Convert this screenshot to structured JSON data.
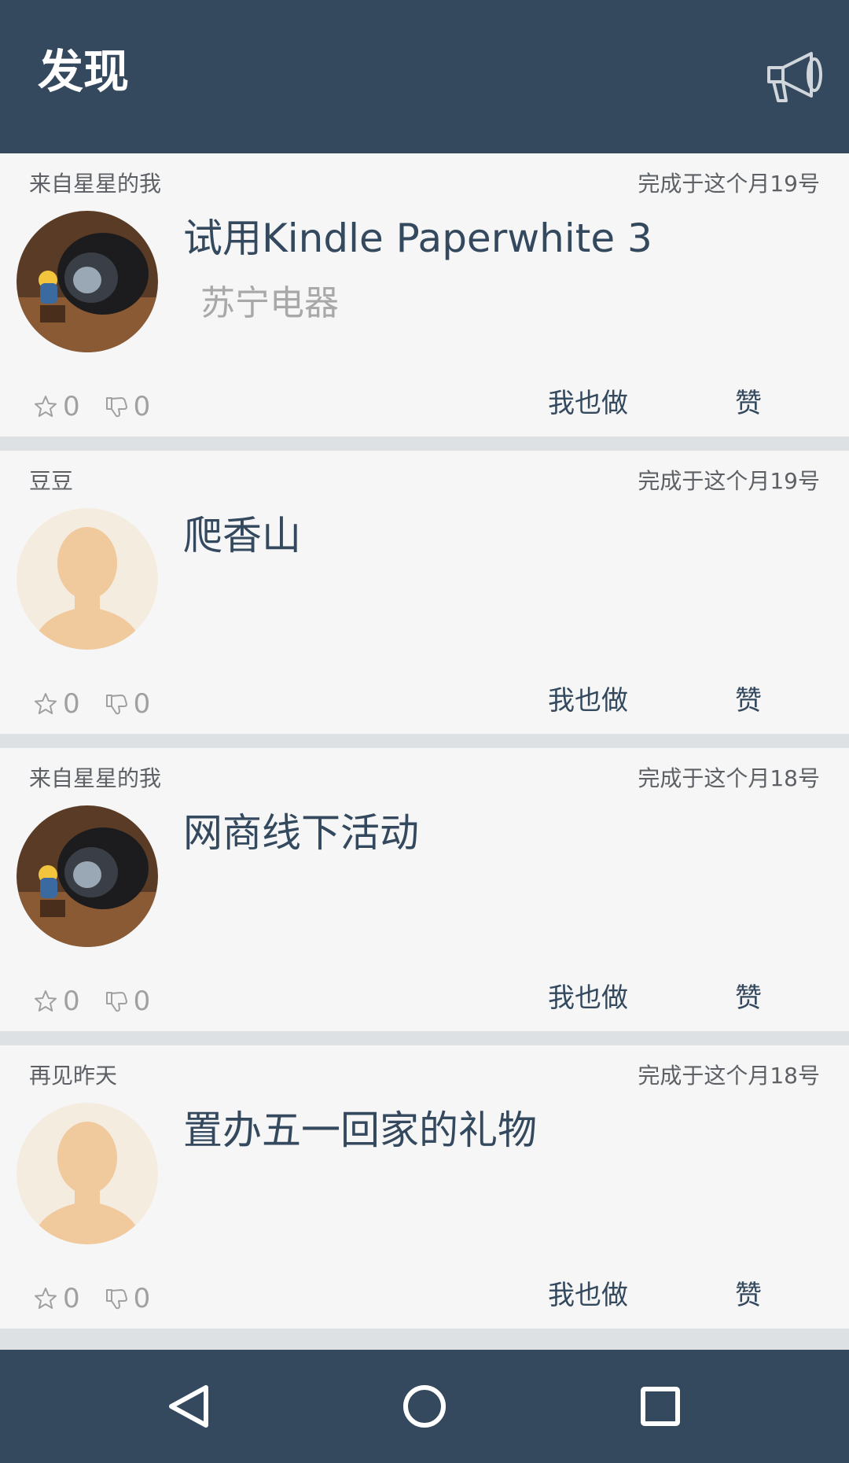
{
  "header": {
    "title": "发现",
    "icon": "megaphone-icon"
  },
  "feed": {
    "do_label": "我也做",
    "like_label": "赞",
    "items": [
      {
        "author": "来自星星的我",
        "completed": "完成于这个月19号",
        "task": "试用Kindle Paperwhite 3",
        "sponsor": "苏宁电器",
        "avatar": "camera-lens-photo",
        "stars": "0",
        "dislikes": "0"
      },
      {
        "author": "豆豆",
        "completed": "完成于这个月19号",
        "task": "爬香山",
        "sponsor": "",
        "avatar": "default-user-avatar",
        "stars": "0",
        "dislikes": "0"
      },
      {
        "author": "来自星星的我",
        "completed": "完成于这个月18号",
        "task": "网商线下活动",
        "sponsor": "",
        "avatar": "camera-lens-photo",
        "stars": "0",
        "dislikes": "0"
      },
      {
        "author": "再见昨天",
        "completed": "完成于这个月18号",
        "task": "置办五一回家的礼物",
        "sponsor": "",
        "avatar": "default-user-avatar",
        "stars": "0",
        "dislikes": "0"
      }
    ]
  },
  "navbar": {
    "icons": [
      "back-icon",
      "home-icon",
      "recents-icon"
    ]
  },
  "colors": {
    "primary": "#34495e",
    "card": "#f6f6f6",
    "divider": "#dde1e4"
  }
}
